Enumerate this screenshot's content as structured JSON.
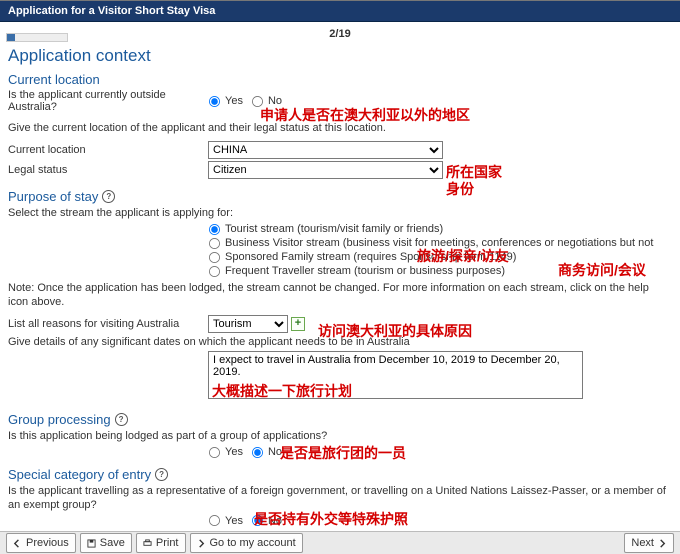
{
  "title": "Application for a Visitor Short Stay Visa",
  "step": "2/19",
  "headings": {
    "context": "Application context",
    "currloc": "Current location",
    "purpose": "Purpose of stay",
    "group": "Group processing",
    "special": "Special category of entry"
  },
  "currloc": {
    "q_outside": "Is the applicant currently outside Australia?",
    "yes": "Yes",
    "no": "No",
    "give_loc": "Give the current location of the applicant and their legal status at this location.",
    "label_loc": "Current location",
    "val_loc": "CHINA",
    "label_status": "Legal status",
    "val_status": "Citizen"
  },
  "purpose": {
    "select_stream": "Select the stream the applicant is applying for:",
    "streams": [
      "Tourist stream (tourism/visit family or friends)",
      "Business Visitor stream (business visit for meetings, conferences or negotiations but not",
      "Sponsored Family stream (requires Sponsorship form 1149)",
      "Frequent Traveller stream (tourism or business purposes)"
    ],
    "note": "Note: Once the application has been lodged, the stream cannot be changed. For more information on each stream, click on the help icon above.",
    "reasons_label": "List all reasons for visiting Australia",
    "reason_val": "Tourism",
    "details_label": "Give details of any significant dates on which the applicant needs to be in Australia",
    "details_val": "I expect to travel in Australia from December 10, 2019 to December 20, 2019."
  },
  "group": {
    "q": "Is this application being lodged as part of a group of applications?",
    "yes": "Yes",
    "no": "No"
  },
  "special": {
    "q": "Is the applicant travelling as a representative of a foreign government, or travelling on a United Nations Laissez-Passer, or a member of an exempt group?",
    "yes": "Yes",
    "no": "No"
  },
  "footer": {
    "previous": "Previous",
    "save": "Save",
    "print": "Print",
    "goto": "Go to my account",
    "next": "Next"
  },
  "annot": {
    "a1": "申请人是否在澳大利亚以外的地区",
    "a2": "所在国家",
    "a3": "身份",
    "a4": "旅游/探亲/访友",
    "a5": "商务访问/会议",
    "a6": "访问澳大利亚的具体原因",
    "a7": "大概描述一下旅行计划",
    "a8": "是否是旅行团的一员",
    "a9": "是否持有外交等特殊护照"
  }
}
